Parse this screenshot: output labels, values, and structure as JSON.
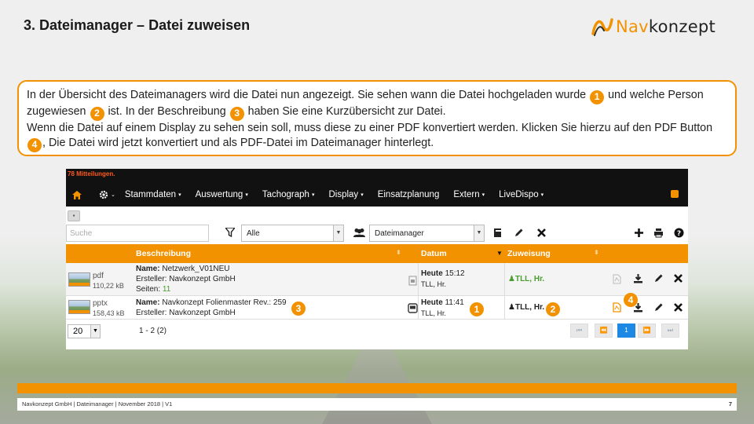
{
  "slide": {
    "title": "3. Dateimanager – Datei zuweisen",
    "logo": {
      "part1": "Nav",
      "part2": "konzept"
    },
    "callout": {
      "s1": "In der Übersicht des Dateimanagers wird die Datei nun angezeigt. Sie sehen wann die Datei hochgeladen wurde",
      "n1": "1",
      "s2": " und welche Person zugewiesen",
      "n2": "2",
      "s3": " ist. In der Beschreibung",
      "n3": "3",
      "s4": " haben Sie eine Kurzübersicht zur Datei.",
      "s5": "Wenn die Datei auf einem Display zu sehen sein soll, muss diese zu einer PDF konvertiert werden. Klicken Sie hierzu auf den PDF Button",
      "n4": "4",
      "s6": ", Die Datei wird jetzt konvertiert und als PDF-Datei im Dateimanager hinterlegt."
    },
    "footer": {
      "text": "Navkonzept GmbH  |  Dateimanager  |  November 2018  |  V1",
      "page": "7"
    },
    "accent_color": "#f39200"
  },
  "app": {
    "messages": "78 Mitteilungen.",
    "menu": [
      {
        "label": "Stammdaten",
        "caret": true
      },
      {
        "label": "Auswertung",
        "caret": true
      },
      {
        "label": "Tachograph",
        "caret": true
      },
      {
        "label": "Display",
        "caret": true
      },
      {
        "label": "Einsatzplanung",
        "caret": false
      },
      {
        "label": "Extern",
        "caret": true
      },
      {
        "label": "LiveDispo",
        "caret": true
      }
    ],
    "search_placeholder": "Suche",
    "filter_value": "Alle",
    "group_value": "Dateimanager",
    "columns": {
      "beschreibung": "Beschreibung",
      "datum": "Datum",
      "zuweisung": "Zuweisung"
    },
    "rows": [
      {
        "type": "pdf",
        "size": "110,22 kB",
        "name_label": "Name:",
        "name": "Netzwerk_V01NEU",
        "creator_label": "Ersteller:",
        "creator": "Navkonzept GmbH",
        "pages_label": "Seiten:",
        "pages": "11",
        "date_bold": "Heute",
        "time": "15:12",
        "by": "TLL, Hr.",
        "assign": "TLL, Hr."
      },
      {
        "type": "pptx",
        "size": "158,43 kB",
        "name_label": "Name:",
        "name": "Navkonzept Folienmaster Rev.: 259",
        "creator_label": "Ersteller:",
        "creator": "Navkonzept GmbH",
        "date_bold": "Heute",
        "time": "11:41",
        "by": "TLL, Hr.",
        "assign": "TLL, Hr."
      }
    ],
    "pager": {
      "per_page": "20",
      "range": "1 - 2 (2)",
      "current_page": "1"
    },
    "markers": {
      "m1": "1",
      "m2": "2",
      "m3": "3",
      "m4": "4"
    }
  }
}
